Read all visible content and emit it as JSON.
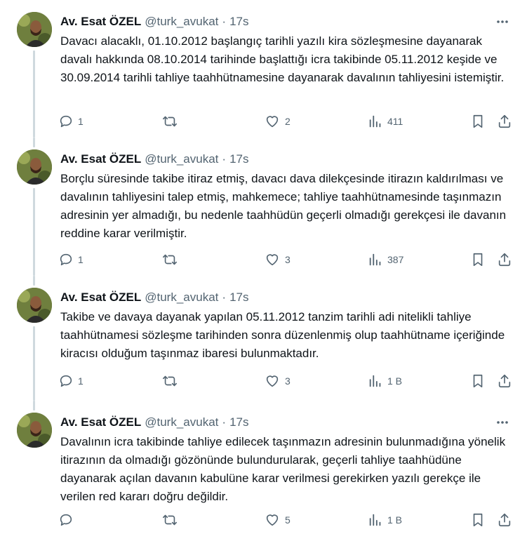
{
  "tweets": [
    {
      "author": {
        "name": "Av. Esat ÖZEL",
        "handle": "@turk_avukat",
        "separator": "·",
        "time": "17s"
      },
      "text": "Davacı alacaklı, 01.10.2012 başlangıç tarihli yazılı kira sözleşmesine dayanarak davalı hakkında 08.10.2014 tarihinde başlattığı icra takibinde 05.11.2012 keşide ve 30.09.2014 tarihli tahliye taahhütnamesine dayanarak davalının tahliyesini istemiştir.",
      "stats": {
        "replies": "1",
        "retweets": "",
        "likes": "2",
        "views": "411"
      }
    },
    {
      "author": {
        "name": "Av. Esat ÖZEL",
        "handle": "@turk_avukat",
        "separator": "·",
        "time": "17s"
      },
      "text": "Borçlu süresinde takibe itiraz etmiş, davacı dava dilekçesinde itirazın kaldırılması ve davalının tahliyesini talep etmiş, mahkemece; tahliye taahhütnamesinde taşınmazın adresinin yer almadığı, bu nedenle taahhüdün geçerli olmadığı gerekçesi ile davanın reddine karar verilmiştir.",
      "stats": {
        "replies": "1",
        "retweets": "",
        "likes": "3",
        "views": "387"
      }
    },
    {
      "author": {
        "name": "Av. Esat ÖZEL",
        "handle": "@turk_avukat",
        "separator": "·",
        "time": "17s"
      },
      "text": "Takibe ve davaya dayanak yapılan 05.11.2012 tanzim tarihli adi nitelikli tahliye taahhütnamesi sözleşme tarihinden sonra düzenlenmiş olup taahhütname içeriğinde kiracısı olduğum taşınmaz ibaresi bulunmaktadır.",
      "stats": {
        "replies": "1",
        "retweets": "",
        "likes": "3",
        "views": "1 B"
      }
    },
    {
      "author": {
        "name": "Av. Esat ÖZEL",
        "handle": "@turk_avukat",
        "separator": "·",
        "time": "17s"
      },
      "text": "Davalının icra takibinde tahliye edilecek taşınmazın adresinin bulunmadığına yönelik itirazının da olmadığı gözönünde bulundurularak, geçerli tahliye taahhüdüne dayanarak açılan davanın kabulüne karar verilmesi gerekirken yazılı gerekçe ile verilen red kararı doğru değildir.",
      "stats": {
        "replies": "",
        "retweets": "",
        "likes": "5",
        "views": "1 B"
      }
    }
  ],
  "icons": {
    "more": "more-icon",
    "reply": "reply-icon",
    "retweet": "retweet-icon",
    "like": "like-icon",
    "views": "views-icon",
    "bookmark": "bookmark-icon",
    "share": "share-icon"
  },
  "colors": {
    "text": "#0f1419",
    "secondary": "#536471",
    "connector": "#cfd9de",
    "background": "#ffffff"
  }
}
